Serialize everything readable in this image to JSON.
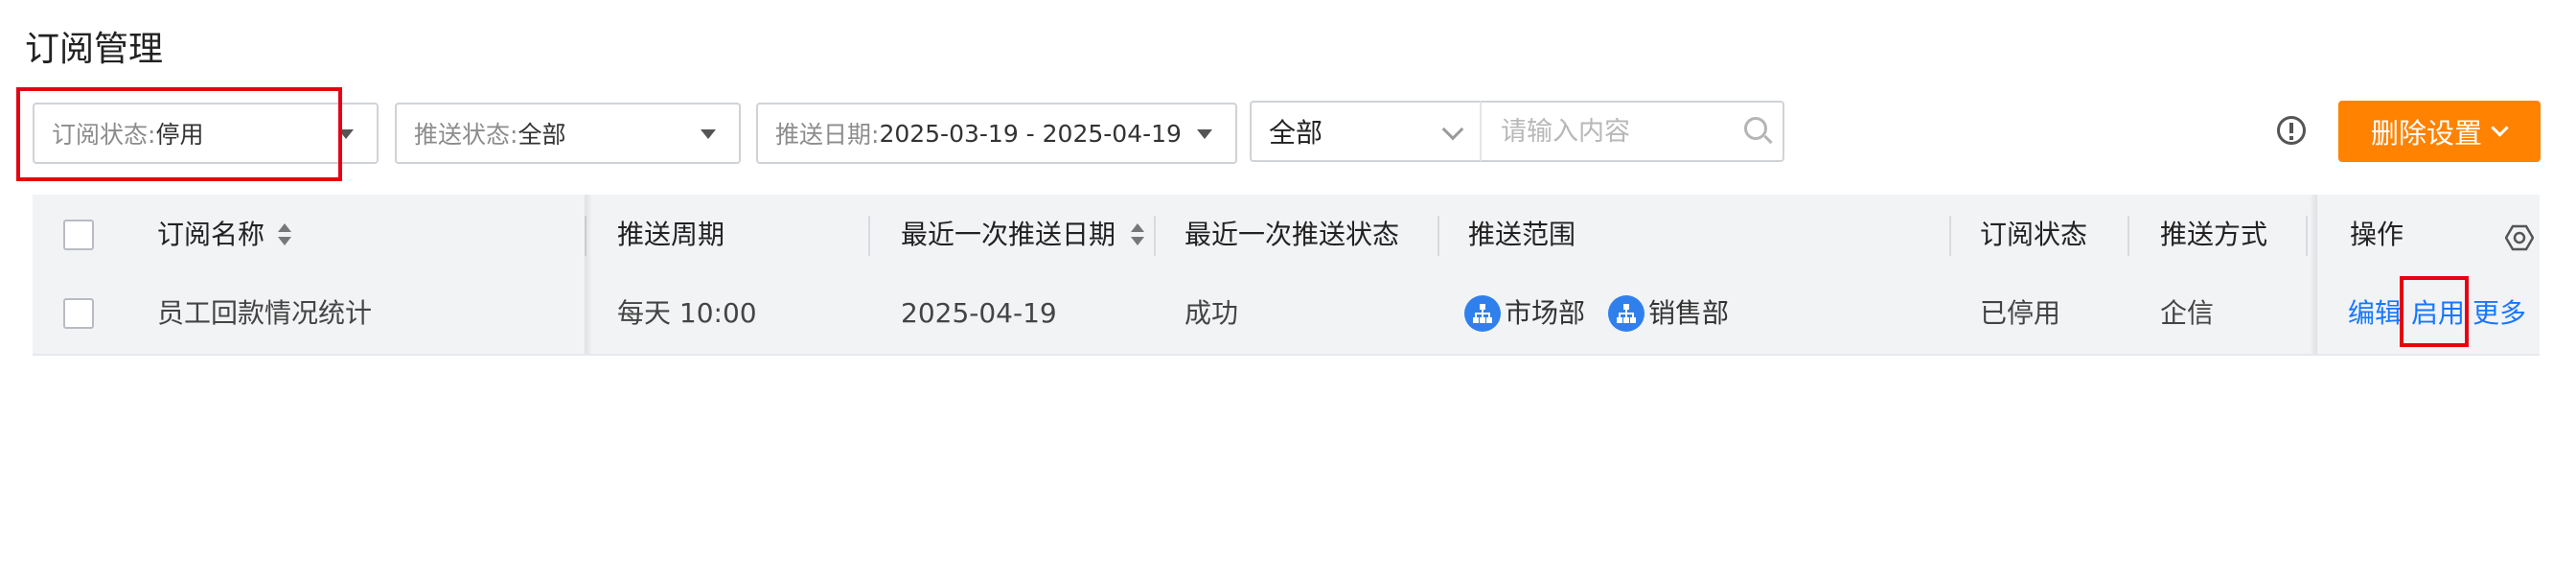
{
  "page_title": "订阅管理",
  "filters": {
    "subscription_status": {
      "label": "订阅状态:",
      "value": "停用"
    },
    "push_status": {
      "label": "推送状态:",
      "value": "全部"
    },
    "push_date": {
      "label": "推送日期:",
      "value": "2025-03-19 - 2025-04-19"
    }
  },
  "search": {
    "scope": "全部",
    "placeholder": "请输入内容"
  },
  "toolbar": {
    "delete_settings_label": "删除设置"
  },
  "table": {
    "columns": [
      "订阅名称",
      "推送周期",
      "最近一次推送日期",
      "最近一次推送状态",
      "推送范围",
      "订阅状态",
      "推送方式",
      "操作"
    ],
    "rows": [
      {
        "name": "员工回款情况统计",
        "cycle": "每天 10:00",
        "last_push_date": "2025-04-19",
        "last_push_status": "成功",
        "scope": [
          "市场部",
          "销售部"
        ],
        "status": "已停用",
        "method": "企信",
        "actions": [
          "编辑",
          "启用",
          "更多"
        ]
      }
    ]
  },
  "colors": {
    "accent": "#ff8200",
    "link": "#1677ff",
    "highlight": "#e60012",
    "dept_icon": "#2f80ed"
  },
  "icons": [
    "caret-down-icon",
    "chevron-down-icon",
    "search-icon",
    "info-icon",
    "sort-icon",
    "column-settings-icon",
    "department-icon"
  ]
}
